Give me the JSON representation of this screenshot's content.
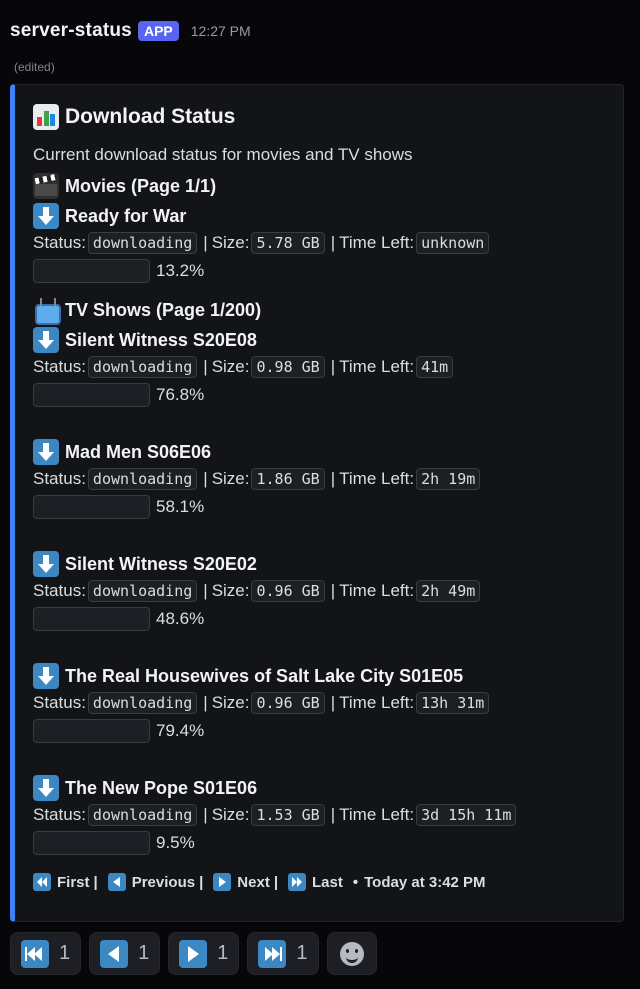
{
  "header": {
    "bot_name": "server-status",
    "badge": "APP",
    "time": "12:27 PM",
    "edited": "(edited)"
  },
  "embed": {
    "accent_color": "#3b82f6",
    "title": "Download Status",
    "title_icon": "bar-chart-icon",
    "description": "Current download status for movies and TV shows",
    "movies": {
      "heading": "Movies (Page 1/1)",
      "icon": "clapper-board-icon",
      "items": [
        {
          "title": "Ready for War",
          "status_label": "Status:",
          "status": "downloading",
          "size_label": "Size:",
          "size": "5.78 GB",
          "time_label": "Time Left:",
          "time_left": "unknown",
          "progress": 13.2,
          "percent": "13.2%"
        }
      ]
    },
    "tv": {
      "heading": "TV Shows (Page 1/200)",
      "icon": "television-icon",
      "items": [
        {
          "title": "Silent Witness S20E08",
          "status_label": "Status:",
          "status": "downloading",
          "size_label": "Size:",
          "size": "0.98 GB",
          "time_label": "Time Left:",
          "time_left": "41m",
          "progress": 76.8,
          "percent": "76.8%"
        },
        {
          "title": "Mad Men S06E06",
          "status_label": "Status:",
          "status": "downloading",
          "size_label": "Size:",
          "size": "1.86 GB",
          "time_label": "Time Left:",
          "time_left": "2h 19m",
          "progress": 58.1,
          "percent": "58.1%"
        },
        {
          "title": "Silent Witness S20E02",
          "status_label": "Status:",
          "status": "downloading",
          "size_label": "Size:",
          "size": "0.96 GB",
          "time_label": "Time Left:",
          "time_left": "2h 49m",
          "progress": 48.6,
          "percent": "48.6%"
        },
        {
          "title": "The Real Housewives of Salt Lake City S01E05",
          "status_label": "Status:",
          "status": "downloading",
          "size_label": "Size:",
          "size": "0.96 GB",
          "time_label": "Time Left:",
          "time_left": "13h 31m",
          "progress": 79.4,
          "percent": "79.4%"
        },
        {
          "title": "The New Pope S01E06",
          "status_label": "Status:",
          "status": "downloading",
          "size_label": "Size:",
          "size": "1.53 GB",
          "time_label": "Time Left:",
          "time_left": "3d 15h 11m",
          "progress": 9.5,
          "percent": "9.5%"
        }
      ]
    },
    "footer": {
      "first": "First",
      "previous": "Previous",
      "next": "Next",
      "last": "Last",
      "separator": "|",
      "bullet": "•",
      "timestamp": "Today at 3:42 PM"
    }
  },
  "reactions": [
    {
      "icon": "first-track-icon",
      "count": "1"
    },
    {
      "icon": "previous-arrow-icon",
      "count": "1"
    },
    {
      "icon": "next-arrow-icon",
      "count": "1"
    },
    {
      "icon": "last-track-icon",
      "count": "1"
    }
  ]
}
